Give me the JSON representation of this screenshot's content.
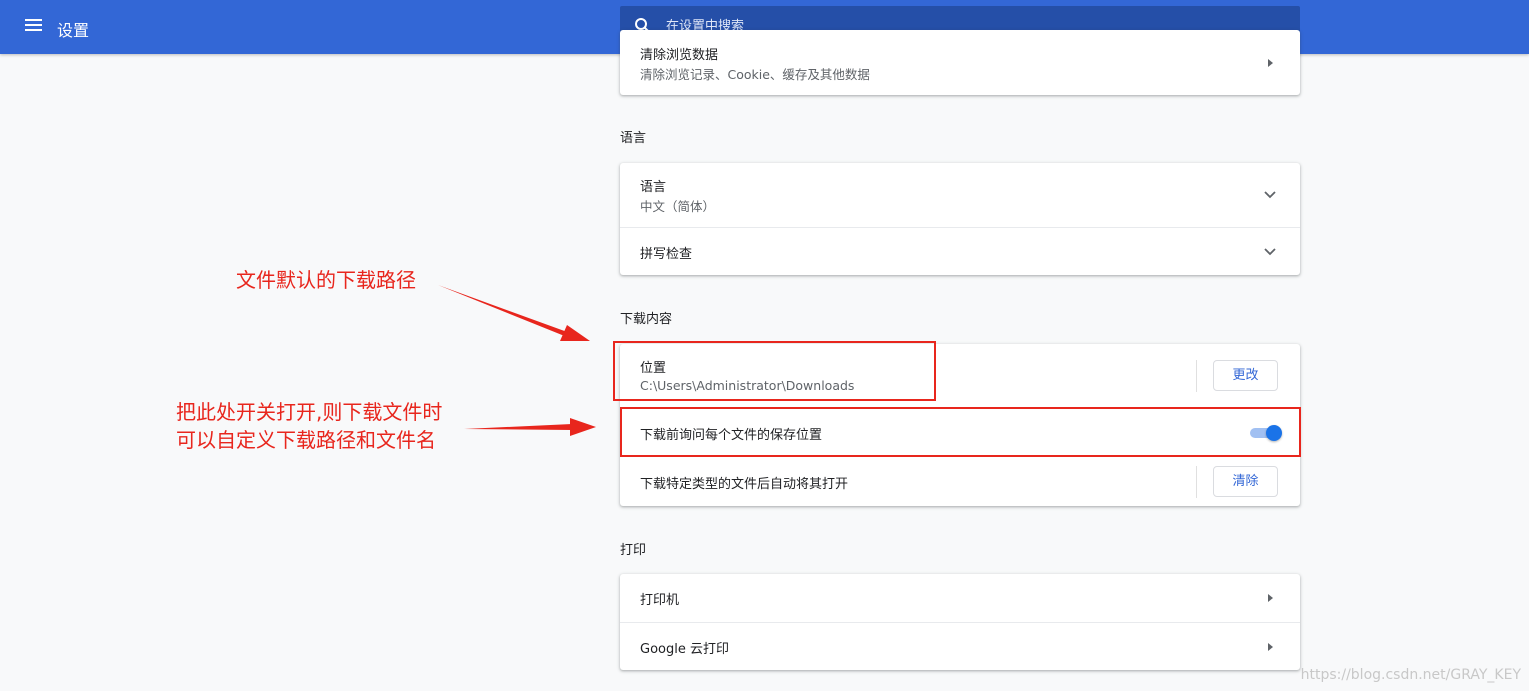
{
  "header": {
    "title": "设置",
    "search_placeholder": "在设置中搜索",
    "bg_color": "#3367d6"
  },
  "privacy": {
    "clear_browsing": {
      "title": "清除浏览数据",
      "subtitle": "清除浏览记录、Cookie、缓存及其他数据"
    }
  },
  "language": {
    "section_title": "语言",
    "language_row": {
      "title": "语言",
      "subtitle": "中文（简体）"
    },
    "spellcheck_row": {
      "title": "拼写检查"
    }
  },
  "downloads": {
    "section_title": "下载内容",
    "location": {
      "title": "位置",
      "path": "C:\\Users\\Administrator\\Downloads",
      "button": "更改"
    },
    "ask_location": {
      "label": "下载前询问每个文件的保存位置",
      "enabled": true
    },
    "auto_open": {
      "label": "下载特定类型的文件后自动将其打开",
      "button": "清除"
    }
  },
  "printing": {
    "section_title": "打印",
    "printers": {
      "title": "打印机"
    },
    "cloud_print": {
      "title": "Google 云打印"
    }
  },
  "annotations": {
    "note1": "文件默认的下载路径",
    "note2_line1": "把此处开关打开,则下载文件时",
    "note2_line2": "可以自定义下载路径和文件名",
    "color": "#e8261d"
  },
  "watermark": "https://blog.csdn.net/GRAY_KEY"
}
